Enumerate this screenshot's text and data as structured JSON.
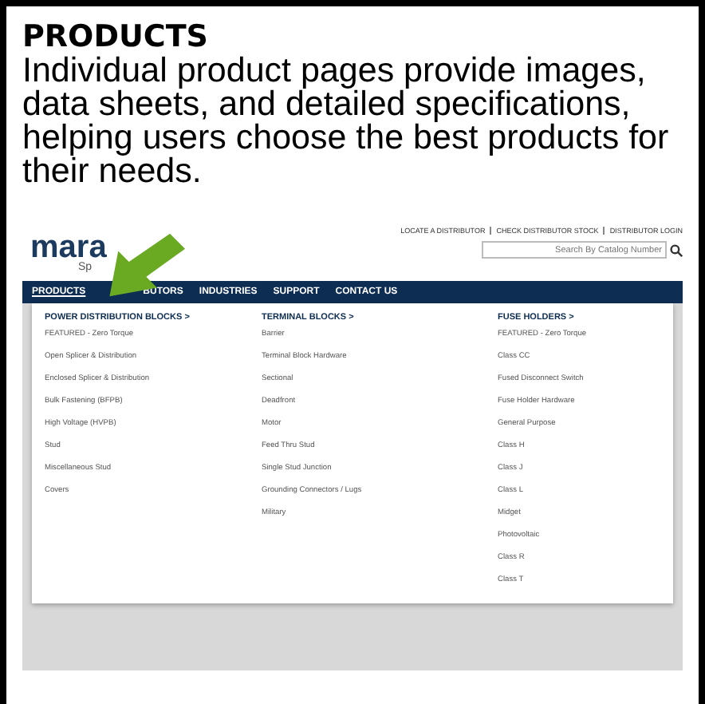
{
  "heading": "PRODUCTS",
  "description": "Individual product pages provide images, data sheets, and detailed specifications, helping users choose the best products for their needs.",
  "website": {
    "logo": "mara",
    "tagline": "Sp",
    "top_links": [
      "LOCATE A DISTRIBUTOR",
      "CHECK DISTRIBUTOR STOCK",
      "DISTRIBUTOR LOGIN"
    ],
    "search": {
      "placeholder": "Search By Catalog Number"
    },
    "nav": [
      {
        "label": "PRODUCTS",
        "selected": true
      },
      {
        "label": "BUTORS",
        "selected": false
      },
      {
        "label": "INDUSTRIES",
        "selected": false
      },
      {
        "label": "SUPPORT",
        "selected": false
      },
      {
        "label": "CONTACT US",
        "selected": false
      }
    ],
    "menu_columns": [
      {
        "title": "POWER DISTRIBUTION BLOCKS >",
        "items": [
          "FEATURED - Zero Torque",
          "Open Splicer & Distribution",
          "Enclosed Splicer & Distribution",
          "Bulk Fastening (BFPB)",
          "High Voltage (HVPB)",
          "Stud",
          "Miscellaneous Stud",
          "Covers"
        ]
      },
      {
        "title": "TERMINAL BLOCKS >",
        "items": [
          "Barrier",
          "Terminal Block Hardware",
          "Sectional",
          "Deadfront",
          "Motor",
          "Feed Thru Stud",
          "Single Stud Junction",
          "Grounding Connectors / Lugs",
          "Military"
        ]
      },
      {
        "title": "FUSE HOLDERS >",
        "items": [
          "FEATURED - Zero Torque",
          "Class CC",
          "Fused Disconnect Switch",
          "Fuse Holder Hardware",
          "General Purpose",
          "Class H",
          "Class J",
          "Class L",
          "Midget",
          "Photovoltaic",
          "Class R",
          "Class T"
        ]
      }
    ]
  }
}
